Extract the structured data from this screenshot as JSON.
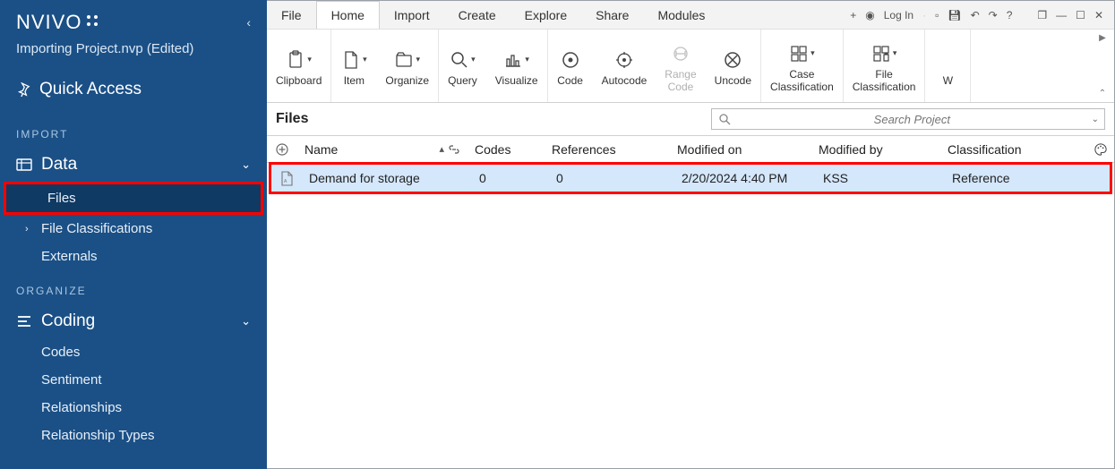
{
  "sidebar": {
    "logo_text": "NVIVO",
    "subtitle": "Importing Project.nvp (Edited)",
    "quick_access": "Quick Access",
    "sections": {
      "import_label": "IMPORT",
      "organize_label": "ORGANIZE"
    },
    "data_group": "Data",
    "data_items": [
      "Files",
      "File Classifications",
      "Externals"
    ],
    "coding_group": "Coding",
    "coding_items": [
      "Codes",
      "Sentiment",
      "Relationships",
      "Relationship Types"
    ]
  },
  "menu": [
    "File",
    "Home",
    "Import",
    "Create",
    "Explore",
    "Share",
    "Modules"
  ],
  "menu_active_index": 1,
  "win_controls": {
    "login": "Log In"
  },
  "ribbon": [
    {
      "items": [
        {
          "label": "Clipboard",
          "icon": "clipboard",
          "dd": true
        }
      ]
    },
    {
      "items": [
        {
          "label": "Item",
          "icon": "file",
          "dd": true
        },
        {
          "label": "Organize",
          "icon": "organize",
          "dd": true
        }
      ]
    },
    {
      "items": [
        {
          "label": "Query",
          "icon": "query",
          "dd": true
        },
        {
          "label": "Visualize",
          "icon": "visualize",
          "dd": true
        }
      ]
    },
    {
      "items": [
        {
          "label": "Code",
          "icon": "code"
        },
        {
          "label": "Autocode",
          "icon": "autocode"
        },
        {
          "label": "Range\nCode",
          "icon": "range",
          "disabled": true
        },
        {
          "label": "Uncode",
          "icon": "uncode"
        }
      ]
    },
    {
      "items": [
        {
          "label": "Case\nClassification",
          "icon": "caseclass",
          "dd": true
        }
      ]
    },
    {
      "items": [
        {
          "label": "File\nClassification",
          "icon": "fileclass",
          "dd": true
        }
      ]
    },
    {
      "items": [
        {
          "label": "W",
          "icon": "",
          "cut": true
        }
      ]
    }
  ],
  "content": {
    "title": "Files",
    "search_placeholder": "Search Project"
  },
  "columns": [
    "Name",
    "Codes",
    "References",
    "Modified on",
    "Modified by",
    "Classification"
  ],
  "rows": [
    {
      "name": "Demand for storage",
      "codes": "0",
      "refs": "0",
      "modified_on": "2/20/2024 4:40 PM",
      "modified_by": "KSS",
      "classification": "Reference",
      "selected": true
    }
  ]
}
